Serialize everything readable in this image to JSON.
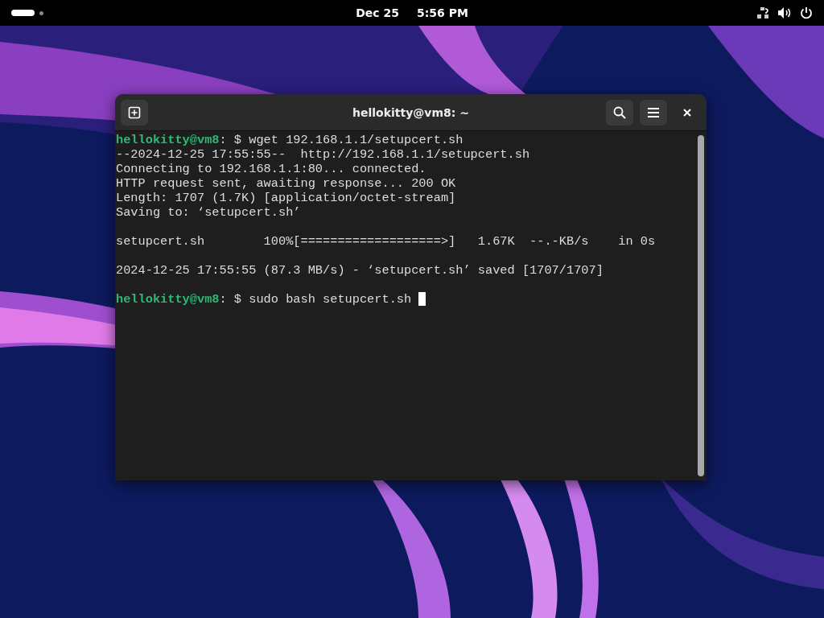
{
  "top_bar": {
    "date": "Dec 25",
    "time": "5:56 PM"
  },
  "terminal": {
    "title": "hellokitty@vm8: ~",
    "lines": [
      {
        "kind": "prompt",
        "user": "hellokitty@vm8",
        "separator": ": $",
        "command": "wget 192.168.1.1/setupcert.sh",
        "cursor": false
      },
      {
        "kind": "output",
        "text": "--2024-12-25 17:55:55--  http://192.168.1.1/setupcert.sh"
      },
      {
        "kind": "output",
        "text": "Connecting to 192.168.1.1:80... connected."
      },
      {
        "kind": "output",
        "text": "HTTP request sent, awaiting response... 200 OK"
      },
      {
        "kind": "output",
        "text": "Length: 1707 (1.7K) [application/octet-stream]"
      },
      {
        "kind": "output",
        "text": "Saving to: ‘setupcert.sh’"
      },
      {
        "kind": "blank"
      },
      {
        "kind": "output",
        "text": "setupcert.sh        100%[===================>]   1.67K  --.-KB/s    in 0s"
      },
      {
        "kind": "blank"
      },
      {
        "kind": "output",
        "text": "2024-12-25 17:55:55 (87.3 MB/s) - ‘setupcert.sh’ saved [1707/1707]"
      },
      {
        "kind": "blank"
      },
      {
        "kind": "prompt",
        "user": "hellokitty@vm8",
        "separator": ": $",
        "command": "sudo bash setupcert.sh",
        "cursor": true
      }
    ]
  }
}
